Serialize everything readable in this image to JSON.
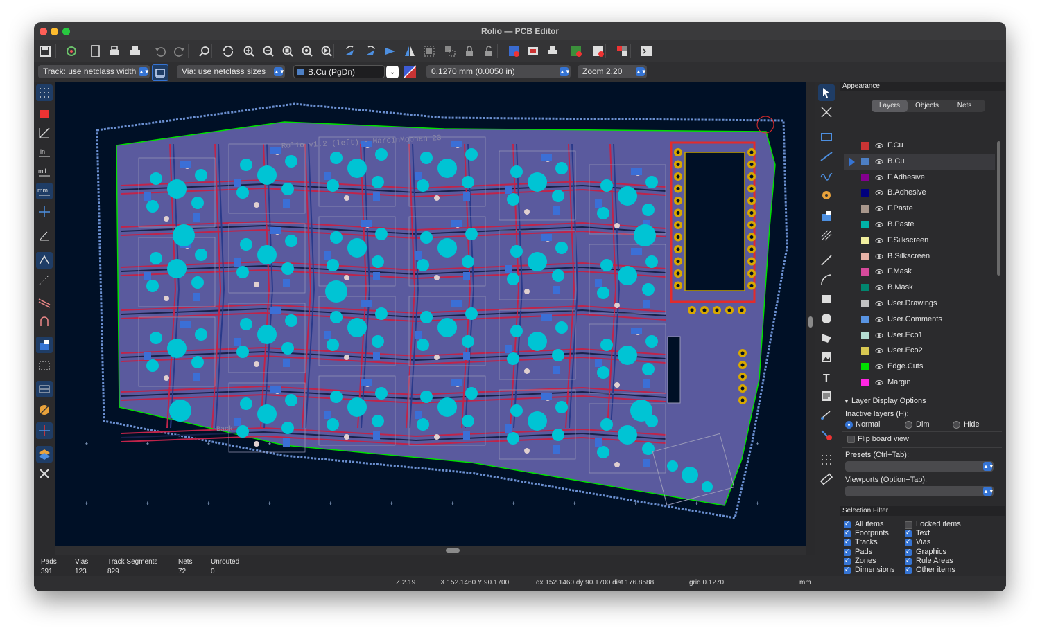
{
  "window": {
    "title": "Rolio — PCB Editor"
  },
  "toolbar": {
    "icons": [
      "save-icon",
      "board-setup-icon",
      "page-settings-icon",
      "print-icon",
      "plot-icon",
      "undo-icon",
      "redo-icon",
      "find-icon",
      "redraw-icon",
      "zoom-in-icon",
      "zoom-out-icon",
      "zoom-fit-icon",
      "zoom-objects-icon",
      "zoom-selection-icon",
      "rotate-ccw-icon",
      "rotate-cw-icon",
      "flip-icon",
      "mirror-icon",
      "group-icon",
      "ungroup-icon",
      "lock-icon",
      "unlock-icon",
      "netlist-icon",
      "footprint-editor-icon",
      "footprint-browser-icon",
      "update-pcb-icon",
      "drc-icon",
      "layer-pair-icon",
      "scripting-console-icon"
    ]
  },
  "options": {
    "track": "Track: use netclass width",
    "via": "Via: use netclass sizes",
    "layer": "B.Cu (PgDn)",
    "grid": "0.1270 mm (0.0050 in)",
    "zoom": "Zoom 2.20"
  },
  "canvas": {
    "board_title": "Rolio v1.2 (left) - MarcinMoonan 23",
    "back_label": "Back",
    "board_color": "#5a5a9e",
    "background_color": "#001026"
  },
  "appearance": {
    "title": "Appearance",
    "tabs": [
      "Layers",
      "Objects",
      "Nets"
    ],
    "active_tab": "Layers",
    "layers": [
      {
        "name": "F.Cu",
        "color": "#c83434"
      },
      {
        "name": "B.Cu",
        "color": "#4d7fc4",
        "selected": true
      },
      {
        "name": "F.Adhesive",
        "color": "#84008e"
      },
      {
        "name": "B.Adhesive",
        "color": "#00007d"
      },
      {
        "name": "F.Paste",
        "color": "#a8978c"
      },
      {
        "name": "B.Paste",
        "color": "#00b2a8"
      },
      {
        "name": "F.Silkscreen",
        "color": "#f0ee9e"
      },
      {
        "name": "B.Silkscreen",
        "color": "#e8b2a7"
      },
      {
        "name": "F.Mask",
        "color": "#d74a9c"
      },
      {
        "name": "B.Mask",
        "color": "#01866f"
      },
      {
        "name": "User.Drawings",
        "color": "#c2c2c2"
      },
      {
        "name": "User.Comments",
        "color": "#5994e2"
      },
      {
        "name": "User.Eco1",
        "color": "#b4dbd2"
      },
      {
        "name": "User.Eco2",
        "color": "#d8c852"
      },
      {
        "name": "Edge.Cuts",
        "color": "#00e000"
      },
      {
        "name": "Margin",
        "color": "#ff26e2"
      }
    ],
    "layer_display_options": "Layer Display Options",
    "inactive_layers_label": "Inactive layers (H):",
    "inactive_options": [
      "Normal",
      "Dim",
      "Hide"
    ],
    "inactive_selected": "Normal",
    "flip_board_view": "Flip board view",
    "presets_label": "Presets (Ctrl+Tab):",
    "viewports_label": "Viewports (Option+Tab):"
  },
  "selection_filter": {
    "title": "Selection Filter",
    "items": [
      {
        "label": "All items",
        "checked": true
      },
      {
        "label": "Locked items",
        "checked": false
      },
      {
        "label": "Footprints",
        "checked": true
      },
      {
        "label": "Text",
        "checked": true
      },
      {
        "label": "Tracks",
        "checked": true
      },
      {
        "label": "Vias",
        "checked": true
      },
      {
        "label": "Pads",
        "checked": true
      },
      {
        "label": "Graphics",
        "checked": true
      },
      {
        "label": "Zones",
        "checked": true
      },
      {
        "label": "Rule Areas",
        "checked": true
      },
      {
        "label": "Dimensions",
        "checked": true
      },
      {
        "label": "Other items",
        "checked": true
      }
    ]
  },
  "stats": [
    {
      "label": "Pads",
      "value": "391"
    },
    {
      "label": "Vias",
      "value": "123"
    },
    {
      "label": "Track Segments",
      "value": "829"
    },
    {
      "label": "Nets",
      "value": "72"
    },
    {
      "label": "Unrouted",
      "value": "0"
    }
  ],
  "statusbar": {
    "zoom": "Z 2.19",
    "coords": "X 152.1460  Y 90.1700",
    "delta": "dx 152.1460  dy 90.1700  dist 176.8588",
    "grid": "grid 0.1270",
    "units": "mm"
  }
}
